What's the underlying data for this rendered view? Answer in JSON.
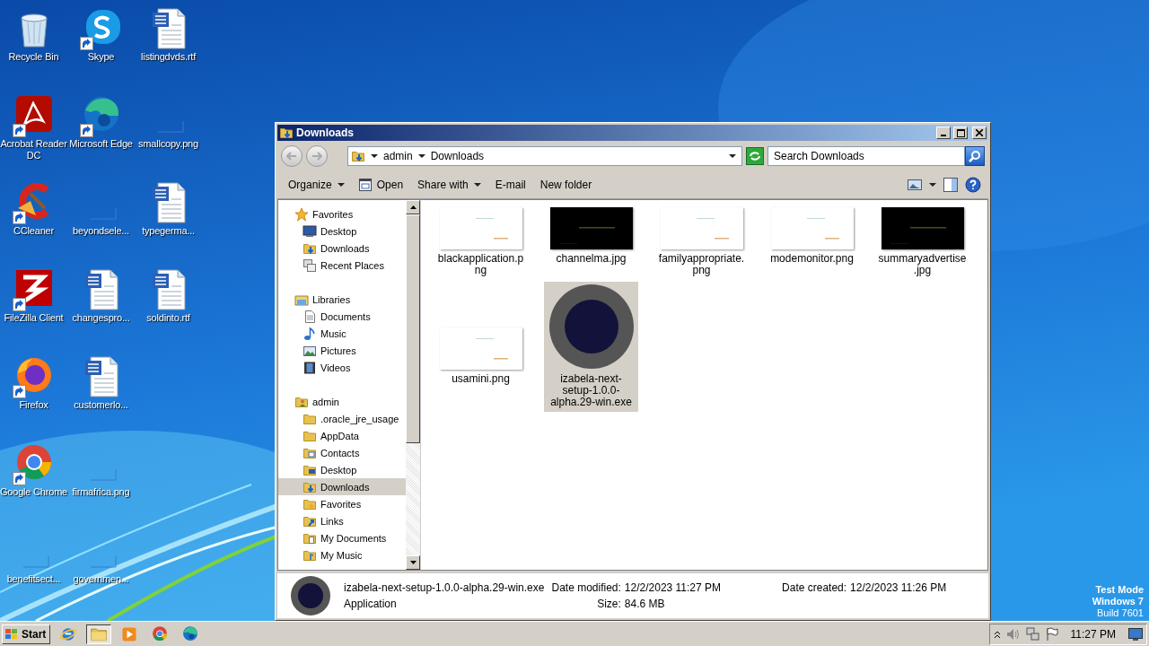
{
  "desktop": {
    "columns": [
      [
        {
          "label": "Recycle Bin",
          "kind": "recycle",
          "shortcut": false
        },
        {
          "label": "Acrobat Reader DC",
          "kind": "pdf",
          "shortcut": true
        },
        {
          "label": "CCleaner",
          "kind": "cleaner",
          "shortcut": true
        },
        {
          "label": "FileZilla Client",
          "kind": "ftp",
          "shortcut": true
        },
        {
          "label": "Firefox",
          "kind": "firefox",
          "shortcut": true
        },
        {
          "label": "Google Chrome",
          "kind": "chrome",
          "shortcut": true
        },
        {
          "label": "benefitsect...",
          "kind": "blank",
          "shortcut": false
        }
      ],
      [
        {
          "label": "Skype",
          "kind": "skype",
          "shortcut": true
        },
        {
          "label": "Microsoft Edge",
          "kind": "edge",
          "shortcut": true
        },
        {
          "label": "beyondsele...",
          "kind": "blank",
          "shortcut": false
        },
        {
          "label": "changespro...",
          "kind": "word",
          "shortcut": false
        },
        {
          "label": "customerlo...",
          "kind": "word",
          "shortcut": false
        },
        {
          "label": "firmafrica.png",
          "kind": "blank",
          "shortcut": false
        },
        {
          "label": "governmen...",
          "kind": "blank",
          "shortcut": false
        }
      ],
      [
        {
          "label": "listingdvds.rtf",
          "kind": "word",
          "shortcut": false
        },
        {
          "label": "smallcopy.png",
          "kind": "blank",
          "shortcut": false
        },
        {
          "label": "typegerma...",
          "kind": "word",
          "shortcut": false
        },
        {
          "label": "soldinto.rtf",
          "kind": "word",
          "shortcut": false
        }
      ]
    ],
    "watermark_lines": [
      "Test Mode",
      "Windows 7",
      "Build 7601"
    ]
  },
  "window": {
    "title": "Downloads",
    "crumbs": [
      "admin",
      "Downloads"
    ],
    "search": {
      "placeholder": "Search Downloads"
    },
    "toolbar": [
      {
        "label": "Organize",
        "kind": "menu"
      },
      {
        "label": "Open",
        "kind": "icon"
      },
      {
        "label": "Share with",
        "kind": "menu"
      },
      {
        "label": "E-mail",
        "kind": "plain"
      },
      {
        "label": "New folder",
        "kind": "plain"
      }
    ],
    "nav": [
      {
        "label": "Favorites",
        "kind": "star",
        "selected": false,
        "children": [
          {
            "label": "Desktop",
            "kind": "monitor",
            "selected": false
          },
          {
            "label": "Downloads",
            "kind": "downloads",
            "selected": false
          },
          {
            "label": "Recent Places",
            "kind": "recent",
            "selected": false
          }
        ]
      },
      {
        "label": "Libraries",
        "kind": "library",
        "selected": false,
        "children": [
          {
            "label": "Documents",
            "kind": "document",
            "selected": false
          },
          {
            "label": "Music",
            "kind": "music",
            "selected": false
          },
          {
            "label": "Pictures",
            "kind": "pictures",
            "selected": false
          },
          {
            "label": "Videos",
            "kind": "videos",
            "selected": false
          }
        ]
      },
      {
        "label": "admin",
        "kind": "user",
        "selected": false,
        "children": [
          {
            "label": ".oracle_jre_usage",
            "kind": "folder",
            "selected": false
          },
          {
            "label": "AppData",
            "kind": "folder",
            "selected": false
          },
          {
            "label": "Contacts",
            "kind": "contacts",
            "selected": false
          },
          {
            "label": "Desktop",
            "kind": "desktop-folder",
            "selected": false
          },
          {
            "label": "Downloads",
            "kind": "downloads",
            "selected": true
          },
          {
            "label": "Favorites",
            "kind": "fav-folder",
            "selected": false
          },
          {
            "label": "Links",
            "kind": "links",
            "selected": false
          },
          {
            "label": "My Documents",
            "kind": "mydocs",
            "selected": false
          },
          {
            "label": "My Music",
            "kind": "mymusic",
            "selected": false
          }
        ]
      }
    ],
    "files": [
      {
        "name": "blackapplication.png",
        "kind": "light",
        "selected": false
      },
      {
        "name": "channelma.jpg",
        "kind": "dark",
        "selected": false
      },
      {
        "name": "familyappropriate.png",
        "kind": "light",
        "selected": false
      },
      {
        "name": "modemonitor.png",
        "kind": "light",
        "selected": false
      },
      {
        "name": "summaryadvertise.jpg",
        "kind": "dark",
        "selected": false
      },
      {
        "name": "usamini.png",
        "kind": "light",
        "selected": false
      },
      {
        "name": "izabela-next-setup-1.0.0-alpha.29-win.exe",
        "kind": "app",
        "selected": true
      }
    ],
    "details": {
      "name": "izabela-next-setup-1.0.0-alpha.29-win.exe",
      "type": "Application",
      "fields": [
        {
          "label": "Date modified:",
          "value": "12/2/2023 11:27 PM"
        },
        {
          "label": "Date created:",
          "value": "12/2/2023 11:26 PM"
        },
        {
          "label": "Size:",
          "value": "84.6 MB"
        }
      ]
    }
  },
  "taskbar": {
    "start": "Start",
    "apps": [
      {
        "kind": "ie",
        "selected": false
      },
      {
        "kind": "explorer",
        "selected": true
      },
      {
        "kind": "media",
        "selected": false
      },
      {
        "kind": "chrome",
        "selected": false
      },
      {
        "kind": "edge",
        "selected": false
      }
    ],
    "clock": "11:27 PM"
  }
}
